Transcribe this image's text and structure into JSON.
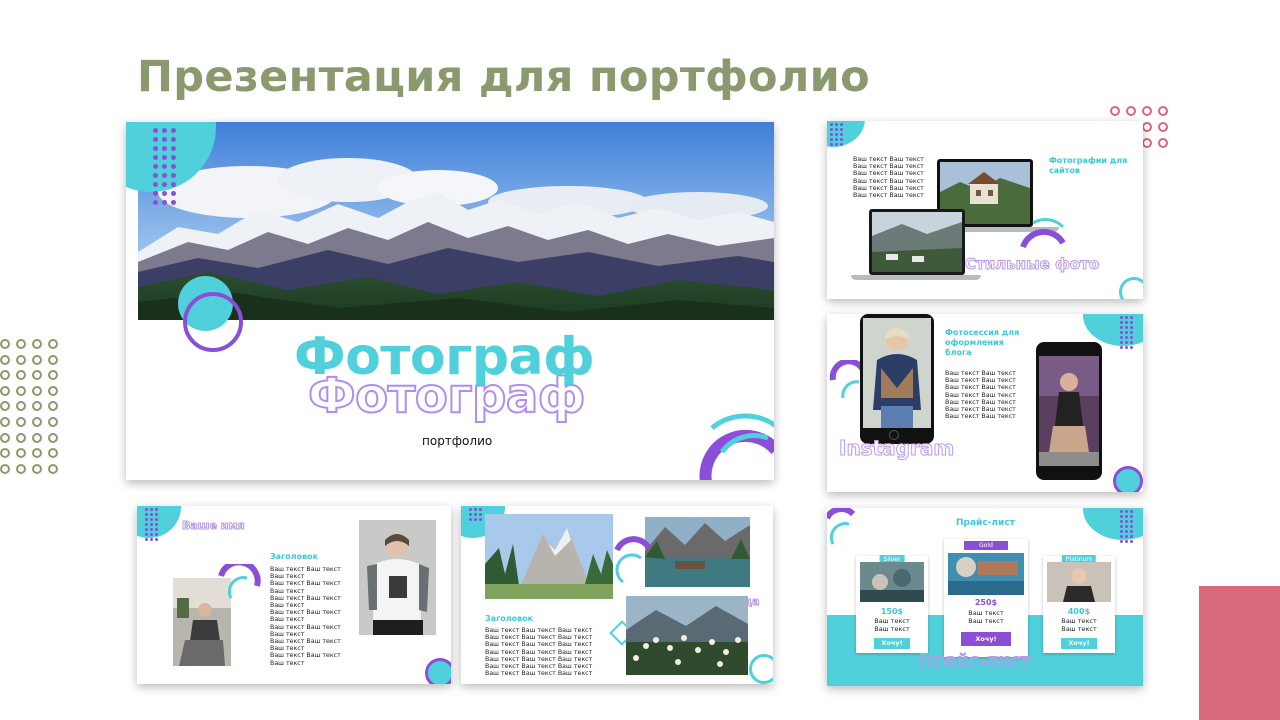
{
  "page_title": "Презентация для портфолио",
  "colors": {
    "title_green": "#8a9a6e",
    "teal": "#4fd0db",
    "purple": "#8a4fd6",
    "pink": "#da6a7b"
  },
  "main_slide": {
    "title": "Фотограф",
    "title_echo": "Фотограф",
    "subtitle": "портфолио"
  },
  "slide_websites": {
    "body": "Ваш текст Ваш текст\nВаш текст Ваш текст\nВаш текст Ваш текст\nВаш текст Ваш текст\nВаш текст Ваш текст\nВаш текст Ваш текст",
    "heading": "Фотографии для\nсайтов",
    "caption": "Стильные фото"
  },
  "slide_instagram": {
    "heading": "Фотосессия для\nоформления\nблога",
    "body": "Ваш текст Ваш текст\nВаш текст Ваш текст\nВаш текст Ваш текст\nВаш текст Ваш текст\nВаш текст Ваш текст\nВаш текст Ваш текст\nВаш текст Ваш текст",
    "caption": "Instagram"
  },
  "slide_about": {
    "name": "Ваше имя",
    "heading": "Заголовок",
    "body": "Ваш текст Ваш текст\nВаш текст\nВаш текст Ваш текст\nВаш текст\nВаш текст Ваш текст\nВаш текст\nВаш текст Ваш текст\nВаш текст\nВаш текст Ваш текст\nВаш текст\nВаш текст Ваш текст\nВаш текст\nВаш текст Ваш текст\nВаш текст"
  },
  "slide_nature": {
    "heading": "Заголовок",
    "body": "Ваш текст Ваш текст Ваш текст\nВаш текст Ваш текст Ваш текст\nВаш текст Ваш текст Ваш текст\nВаш текст Ваш текст Ваш текст\nВаш текст Ваш текст Ваш текст\nВаш текст Ваш текст Ваш текст\nВаш текст Ваш текст Ваш текст",
    "caption": "Природа"
  },
  "slide_price": {
    "title": "Прайс-лист",
    "watermark": "Прайс-лист",
    "cards": [
      {
        "tier": "Silver",
        "price": "150$",
        "desc": "Ваш текст\nВаш текст",
        "button": "Хочу!"
      },
      {
        "tier": "Gold",
        "price": "250$",
        "desc": "Ваш текст\nВаш текст",
        "button": "Хочу!"
      },
      {
        "tier": "Platinum",
        "price": "400$",
        "desc": "Ваш текст\nВаш текст",
        "button": "Хочу!"
      }
    ]
  }
}
